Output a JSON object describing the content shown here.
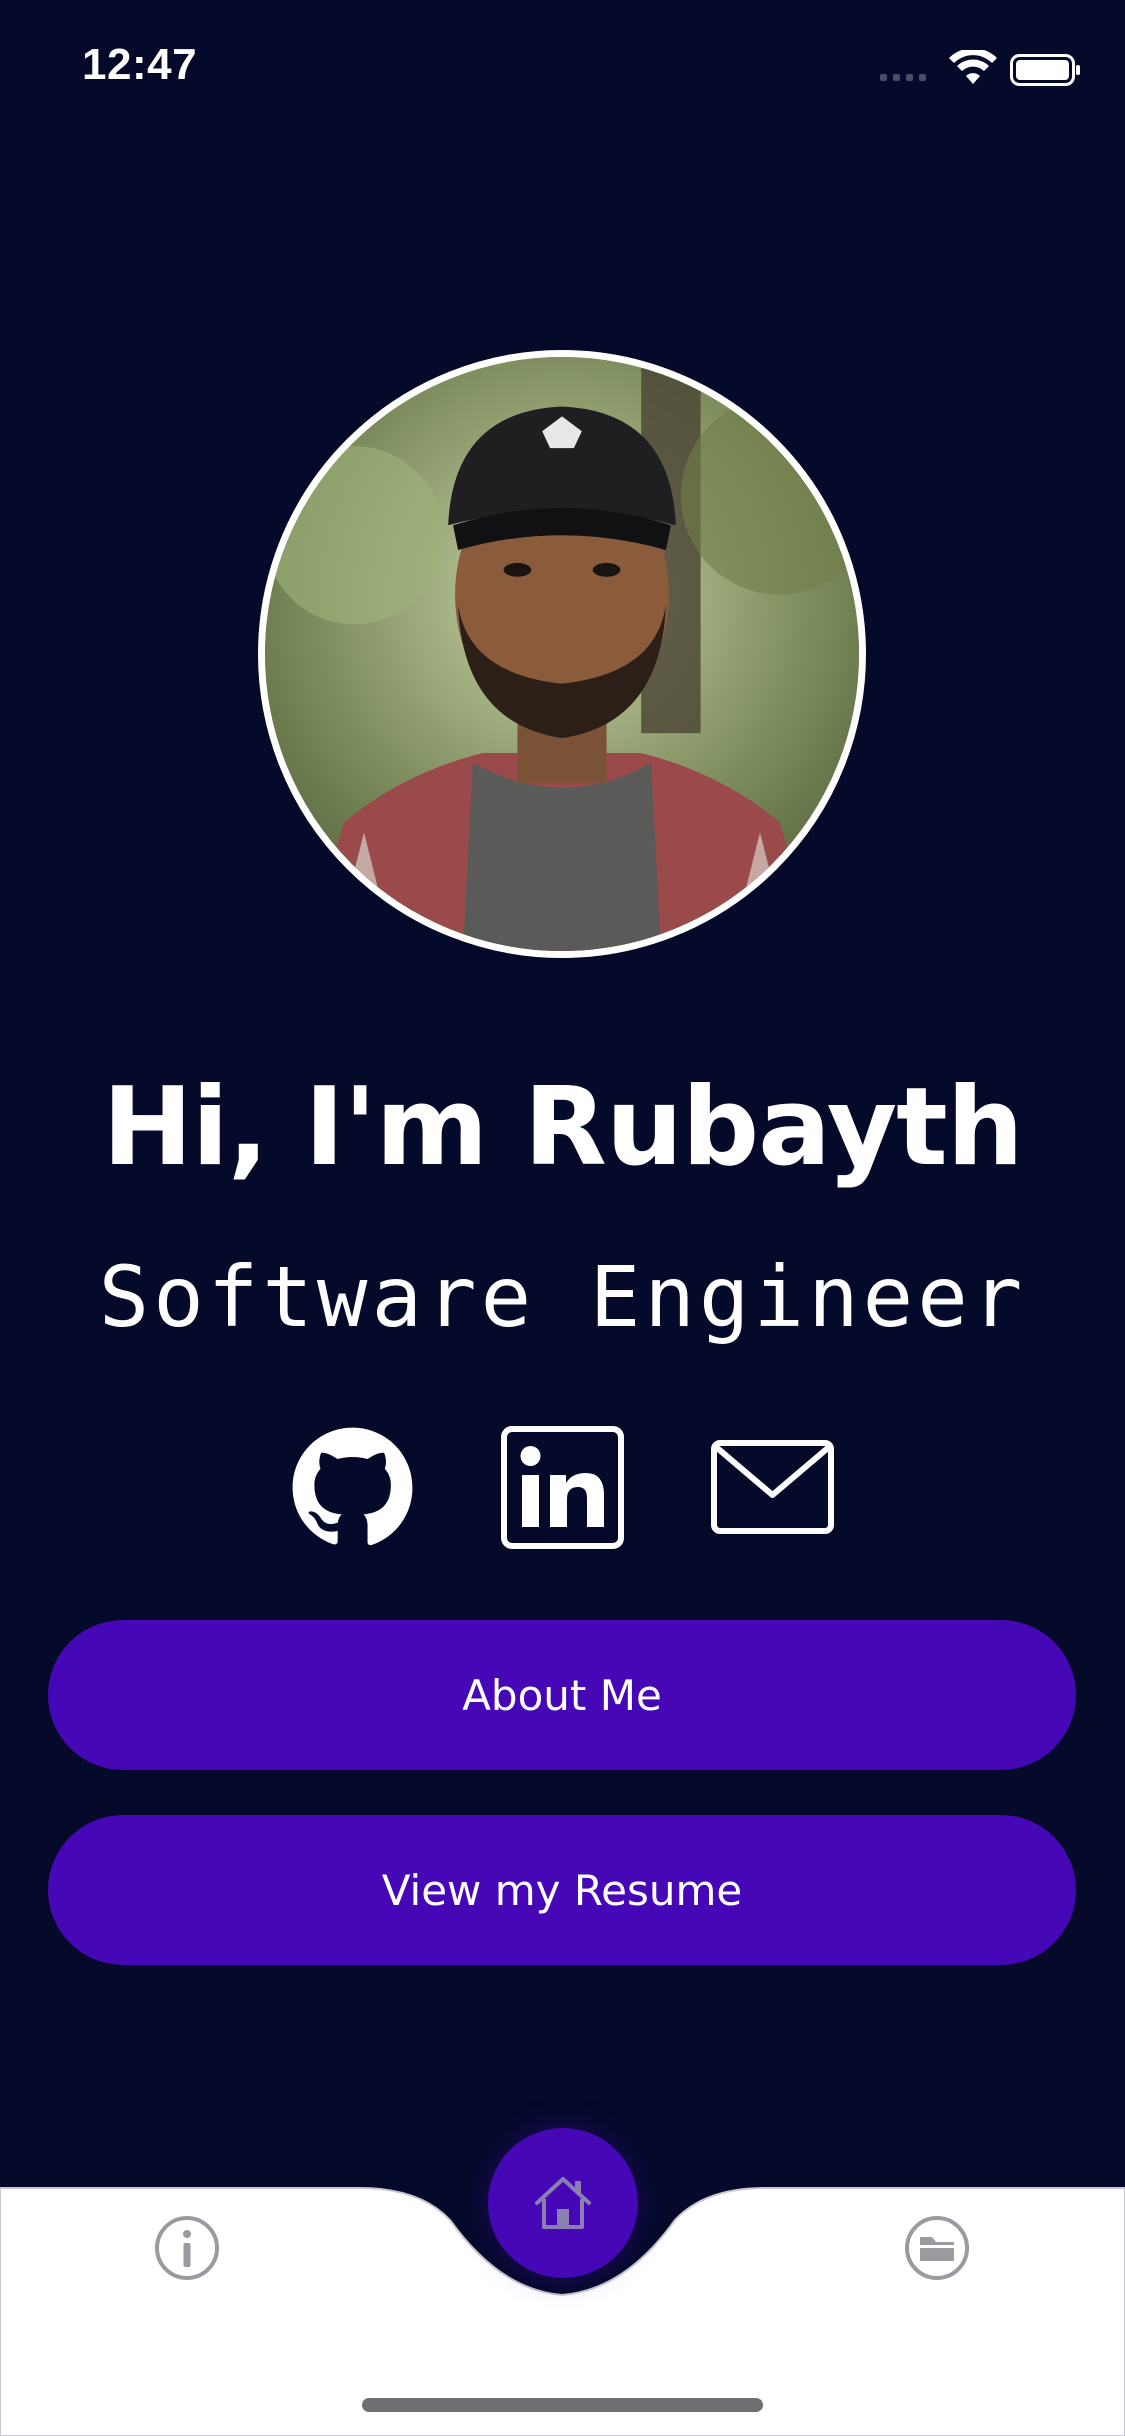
{
  "status_bar": {
    "time": "12:47"
  },
  "profile": {
    "greeting": "Hi, I'm Rubayth",
    "role": "Software Engineer",
    "avatar_icon": "profile-photo"
  },
  "social": {
    "github_icon": "github-icon",
    "linkedin_icon": "linkedin-icon",
    "email_icon": "email-icon"
  },
  "buttons": {
    "about_label": "About Me",
    "resume_label": "View my Resume"
  },
  "tab_bar": {
    "tabs": [
      {
        "icon": "info-icon",
        "active": false
      },
      {
        "icon": "home-icon",
        "active": true
      },
      {
        "icon": "folder-icon",
        "active": false
      }
    ]
  },
  "colors": {
    "background": "#050a2a",
    "accent": "#4608b6",
    "tab_bar": "#ffffff",
    "inactive_icon": "#9a9aa0"
  }
}
